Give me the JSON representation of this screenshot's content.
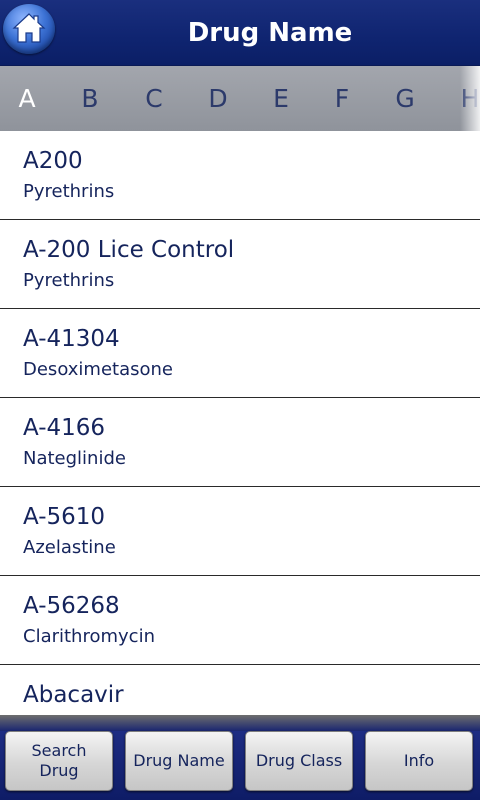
{
  "header": {
    "title": "Drug Name",
    "home_icon": "home-icon"
  },
  "alphabet": {
    "active": "A",
    "letters": [
      "A",
      "B",
      "C",
      "D",
      "E",
      "F",
      "G",
      "H"
    ]
  },
  "drugs": [
    {
      "name": "A200",
      "generic": "Pyrethrins"
    },
    {
      "name": "A-200 Lice Control",
      "generic": "Pyrethrins"
    },
    {
      "name": "A-41304",
      "generic": "Desoximetasone"
    },
    {
      "name": "A-4166",
      "generic": "Nateglinide"
    },
    {
      "name": "A-5610",
      "generic": "Azelastine"
    },
    {
      "name": "A-56268",
      "generic": "Clarithromycin"
    },
    {
      "name": "Abacavir",
      "generic": ""
    }
  ],
  "tabs": {
    "search_line1": "Search",
    "search_line2": "Drug",
    "drug_name": "Drug Name",
    "drug_class": "Drug Class",
    "info": "Info"
  },
  "colors": {
    "header_bg": "#0f2470",
    "alpha_bar_bg": "#9a9ea5",
    "text": "#15245c"
  }
}
